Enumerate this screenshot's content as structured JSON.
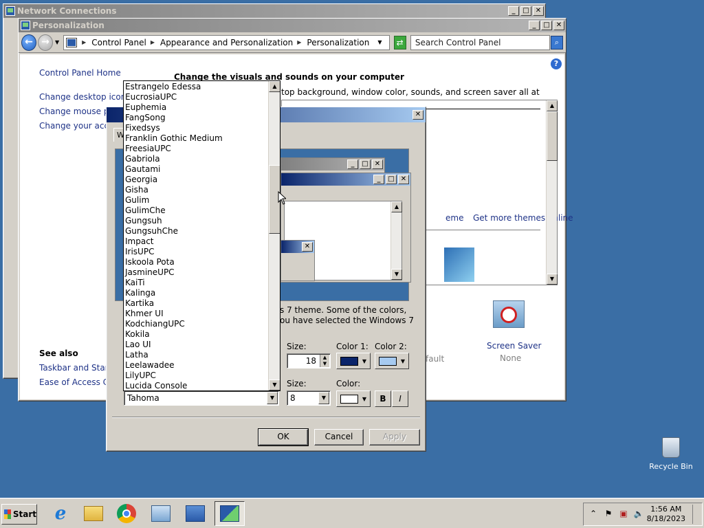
{
  "netwin": {
    "title": "Network Connections"
  },
  "perswin": {
    "title": "Personalization",
    "breadcrumb": [
      "Control Panel",
      "Appearance and Personalization",
      "Personalization"
    ],
    "search_placeholder": "Search Control Panel",
    "sidebar": {
      "home": "Control Panel Home",
      "links": [
        "Change desktop icons",
        "Change mouse point",
        "Change your accoun"
      ],
      "see_also_title": "See also",
      "see_also": [
        "Taskbar and Start M",
        "Ease of Access Cent"
      ]
    },
    "heading": "Change the visuals and sounds on your computer",
    "subheading": "top background, window color, sounds, and screen saver all at once.",
    "theme_link_partial": "eme",
    "get_more_themes": "Get more themes online",
    "screen_saver_label": "Screen Saver",
    "screen_saver_value": "None",
    "sound_partial": "fault"
  },
  "dialog": {
    "tab_partial": "W",
    "info_line1": "s 7 theme.  Some of the colors,",
    "info_line2": "ou have selected the Windows 7",
    "size_label": "Size:",
    "color1_label": "Color 1:",
    "color2_label": "Color 2:",
    "item_size_value": "18",
    "font_size_label": "Size:",
    "font_color_label": "Color:",
    "font_value": "Tahoma",
    "font_size_value": "8",
    "bold_label": "B",
    "italic_label": "I",
    "ok": "OK",
    "cancel": "Cancel",
    "apply": "Apply",
    "colors": {
      "color1": "#0a246a",
      "color2": "#a6caf0",
      "font_color": "#ffffff"
    }
  },
  "fontlist": {
    "items": [
      "Estrangelo Edessa",
      "EucrosiaUPC",
      "Euphemia",
      "FangSong",
      "Fixedsys",
      "Franklin Gothic Medium",
      "FreesiaUPC",
      "Gabriola",
      "Gautami",
      "Georgia",
      "Gisha",
      "Gulim",
      "GulimChe",
      "Gungsuh",
      "GungsuhChe",
      "Impact",
      "IrisUPC",
      "Iskoola Pota",
      "JasmineUPC",
      "KaiTi",
      "Kalinga",
      "Kartika",
      "Khmer UI",
      "KodchiangUPC",
      "Kokila",
      "Lao UI",
      "Latha",
      "Leelawadee",
      "LilyUPC",
      "Lucida Console"
    ]
  },
  "taskbar": {
    "start": "Start",
    "time": "1:56 AM",
    "date": "8/18/2023"
  },
  "desktop": {
    "recycle_bin": "Recycle Bin"
  }
}
